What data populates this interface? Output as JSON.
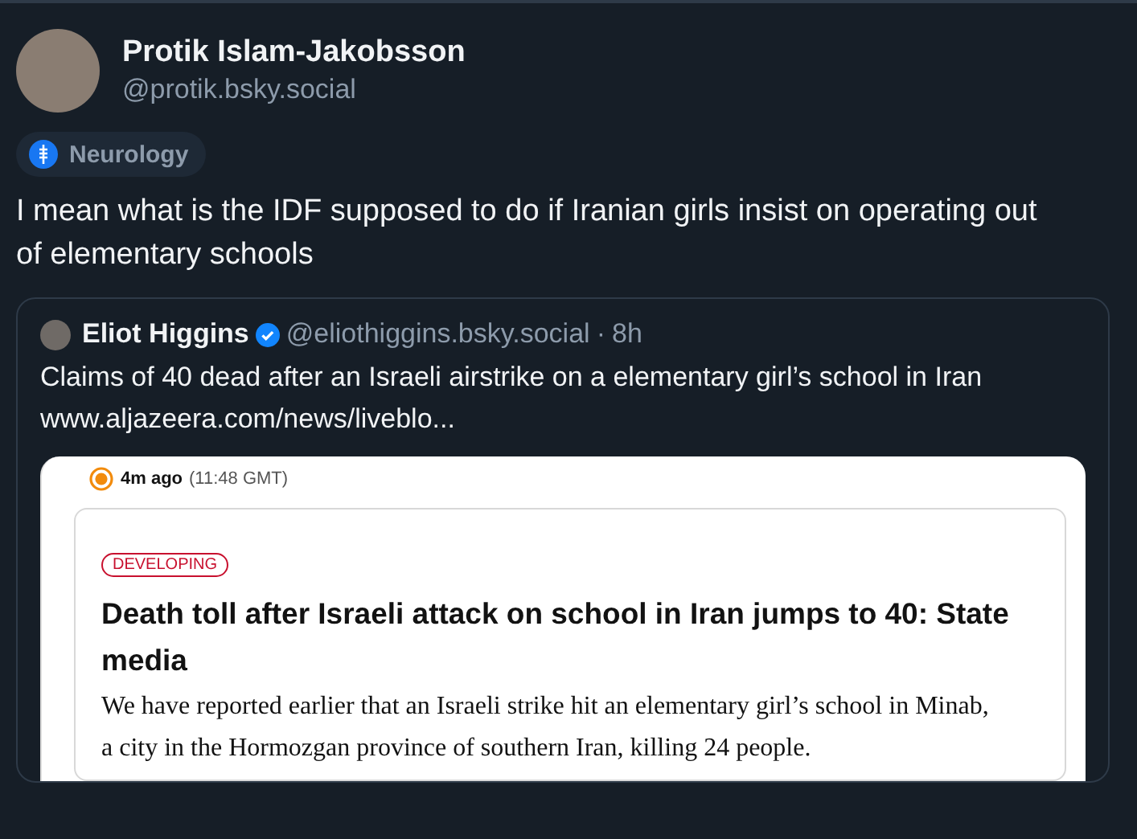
{
  "post": {
    "author_name": "Protik Islam-Jakobsson",
    "author_handle": "@protik.bsky.social",
    "tag": "Neurology",
    "text": "I mean what is the IDF supposed to do if Iranian girls insist on operating out of elementary schools"
  },
  "quote": {
    "author_name": "Eliot Higgins",
    "verified": true,
    "author_handle": "@eliothiggins.bsky.social",
    "separator": "·",
    "time": "8h",
    "text": "Claims of 40 dead after an Israeli airstrike on a elementary girl’s school in Iran",
    "link": "www.aljazeera.com/news/liveblo..."
  },
  "screenshot": {
    "time_ago": "4m ago",
    "time_exact": "(11:48 GMT)",
    "badge": "DEVELOPING",
    "headline": "Death toll after Israeli attack on school in Iran jumps to 40: State media",
    "body": "We have reported earlier that an Israeli strike hit an elementary girl’s school in Minab, a city in the Hormozgan province of southern Iran, killing 24 people."
  }
}
